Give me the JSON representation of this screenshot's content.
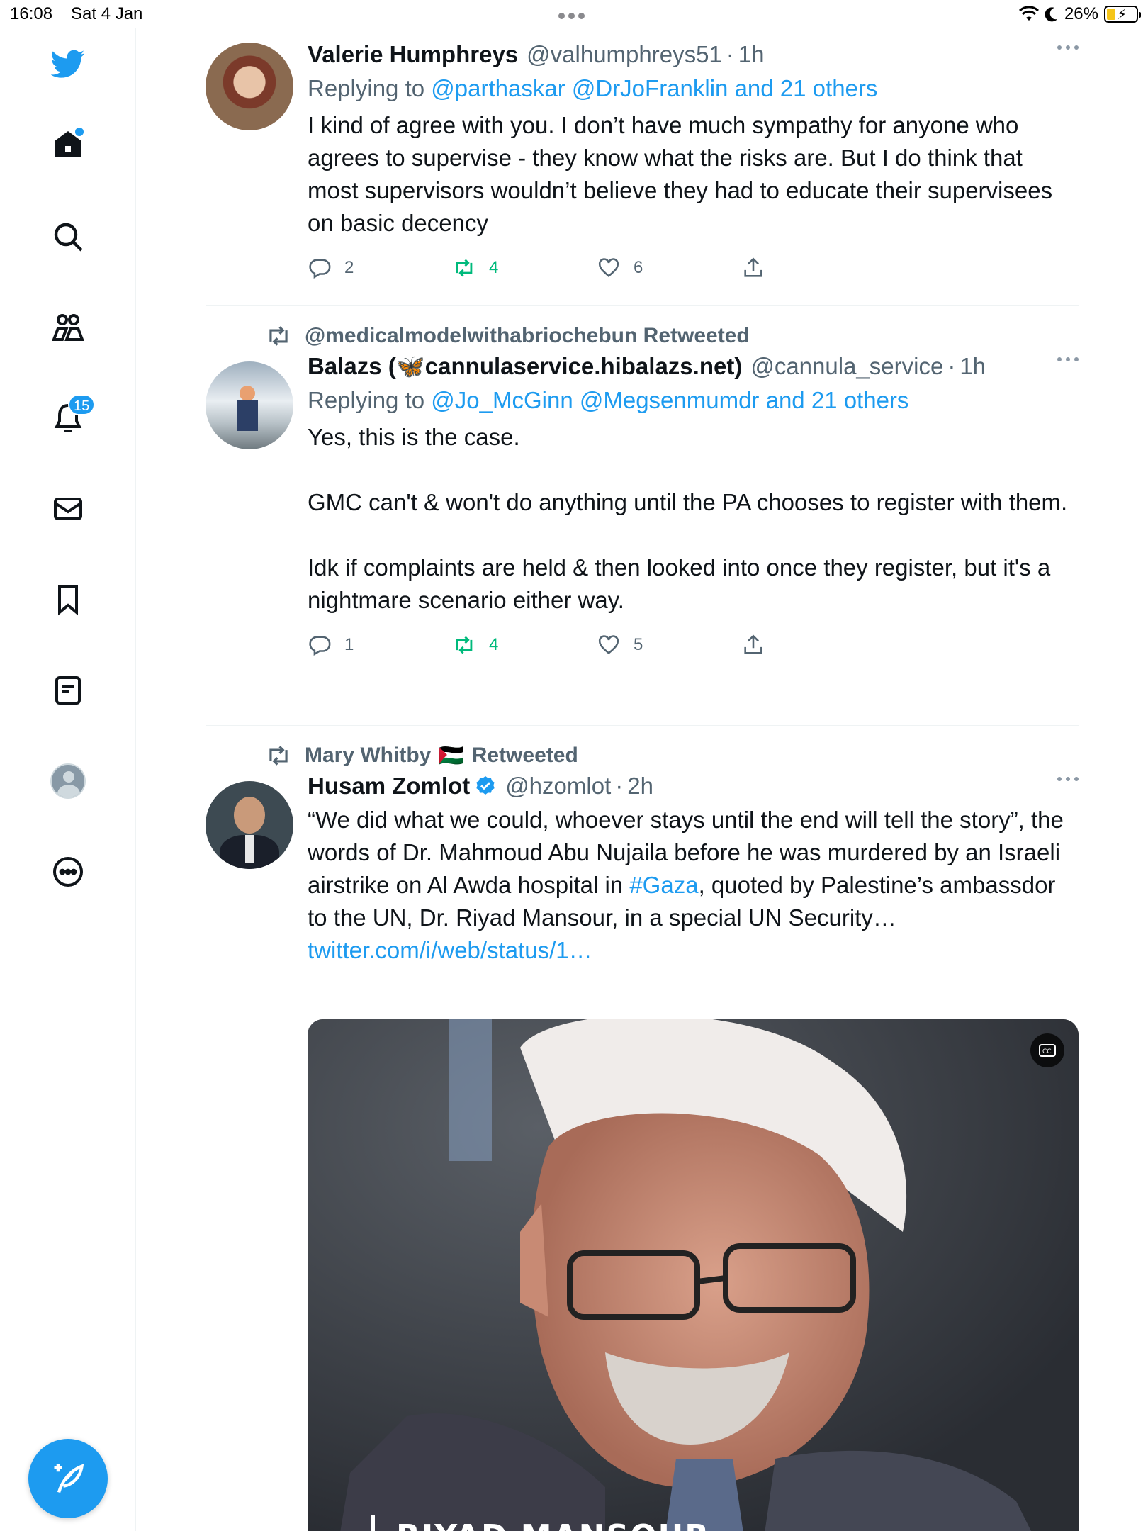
{
  "status_bar": {
    "time": "16:08",
    "date": "Sat 4 Jan",
    "battery": "26%"
  },
  "sidebar": {
    "notifications_badge": "15"
  },
  "colors": {
    "accent": "#1d9bf0",
    "retweet_green": "#00ba7c",
    "muted": "#536471"
  },
  "tweets": [
    {
      "name": "Valerie Humphreys",
      "handle": "@valhumphreys51",
      "time": "1h",
      "replying_prefix": "Replying to",
      "replying_to": "@parthaskar @DrJoFranklin and 21 others",
      "text": "I kind of agree with you. I don’t have much sympathy for anyone who agrees to supervise - they know what the risks are. But I do think that most supervisors wouldn’t believe they had to educate their supervisees on basic decency",
      "replies": "2",
      "retweets": "4",
      "likes": "6"
    },
    {
      "retweeted_by": "@medicalmodelwithabriochebun Retweeted",
      "name": "Balazs (🦋cannulaservice.hibalazs.net)",
      "handle": "@cannula_service",
      "time": "1h",
      "replying_prefix": "Replying to",
      "replying_to": "@Jo_McGinn @Megsenmumdr and 21 others",
      "text_p1": "Yes, this is the case.",
      "text_p2": "GMC can't & won't do anything until the PA chooses to register with them.",
      "text_p3": "Idk if complaints are held & then looked into once they register, but it's a nightmare scenario either way.",
      "replies": "1",
      "retweets": "4",
      "likes": "5"
    },
    {
      "retweeted_by_name": "Mary Whitby",
      "retweeted_by_flag": "🇵🇸",
      "retweeted_label": "Retweeted",
      "name": "Husam Zomlot",
      "handle": "@hzomlot",
      "time": "2h",
      "text_before": "“We did what we could, whoever stays until the end will tell the story”, the words of Dr. Mahmoud Abu Nujaila before he was murdered by an Israeli airstrike on Al Awda hospital in ",
      "hashtag": "#Gaza",
      "text_after": ", quoted by Palestine’s ambassdor to the UN, Dr. Riyad Mansour, in a special UN Security…",
      "link": "twitter.com/i/web/status/1…",
      "media_caption": "RIYAD MANSOUR"
    }
  ]
}
